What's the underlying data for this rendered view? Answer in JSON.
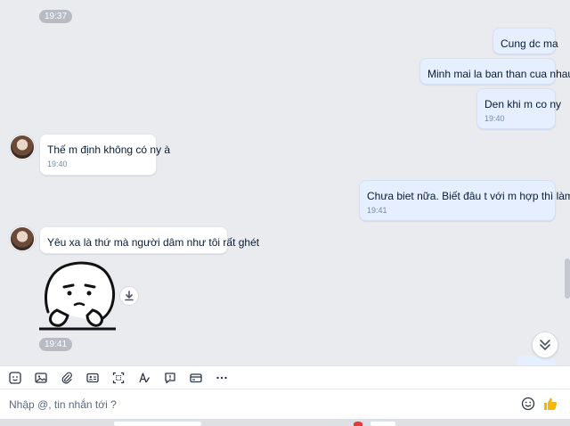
{
  "chat": {
    "time_pill_top": "19:37",
    "messages": [
      {
        "text": "Cung dc ma"
      },
      {
        "text": "Minh mai la ban than cua nhau"
      },
      {
        "text": "Den khi m co ny",
        "time": "19:40"
      },
      {
        "text": "Thế m định không có ny à",
        "time": "19:40"
      },
      {
        "text": "Chưa biet nữa. Biết đâu t với m hợp thì làm ny",
        "time": "19:41"
      },
      {
        "text": "Yêu xa là thứ mà người dâm như tôi rất ghét"
      }
    ],
    "sticker_time": "19:41",
    "sticker_icon": "sticker-face-icon"
  },
  "toolbar": {
    "tools": [
      "sticker-icon",
      "image-icon",
      "attach-icon",
      "contact-card-icon",
      "screenshot-icon",
      "format-text-icon",
      "quick-message-icon",
      "card-icon",
      "more-icon"
    ]
  },
  "composer": {
    "placeholder": "Nhập @, tin nhắn tới ?"
  },
  "colors": {
    "my_bubble": "#e5efff",
    "their_bubble": "#ffffff",
    "background": "#e9ebee",
    "like_thumb": "#f5b700"
  }
}
